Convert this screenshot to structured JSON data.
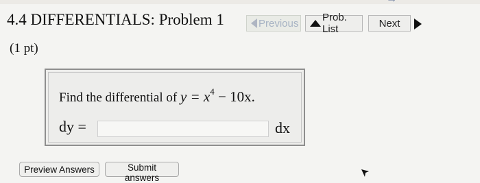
{
  "header": {
    "title": "4.4 DIFFERENTIALS: Problem 1",
    "banner_text": "→"
  },
  "nav": {
    "previous_label": "Previous",
    "problist_label": "Prob. List",
    "next_label": "Next"
  },
  "problem": {
    "points": "(1 pt)",
    "prompt_text": "Find the differential of ",
    "equation_lhs": "y = x",
    "equation_exp": "4",
    "equation_rhs": " − 10x.",
    "dy_label": "dy =",
    "answer_value": "",
    "answer_placeholder": "",
    "dx_label": "dx"
  },
  "actions": {
    "preview_label": "Preview Answers",
    "submit_label": "Submit answers"
  }
}
